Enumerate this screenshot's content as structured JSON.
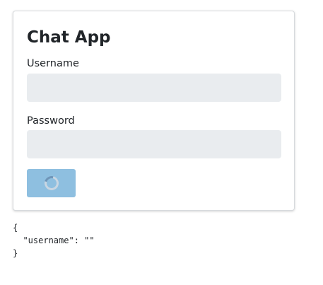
{
  "login": {
    "title": "Chat App",
    "username_label": "Username",
    "username_value": "",
    "password_label": "Password",
    "password_value": "",
    "submit_state": "loading",
    "submit_spinner_icon": "spinner-icon"
  },
  "debug": {
    "text": "{\n  \"username\": \"\"\n}"
  },
  "colors": {
    "field_bg": "#e9ecef",
    "button_bg": "#8ebfe0",
    "card_border": "#d7dadd"
  }
}
